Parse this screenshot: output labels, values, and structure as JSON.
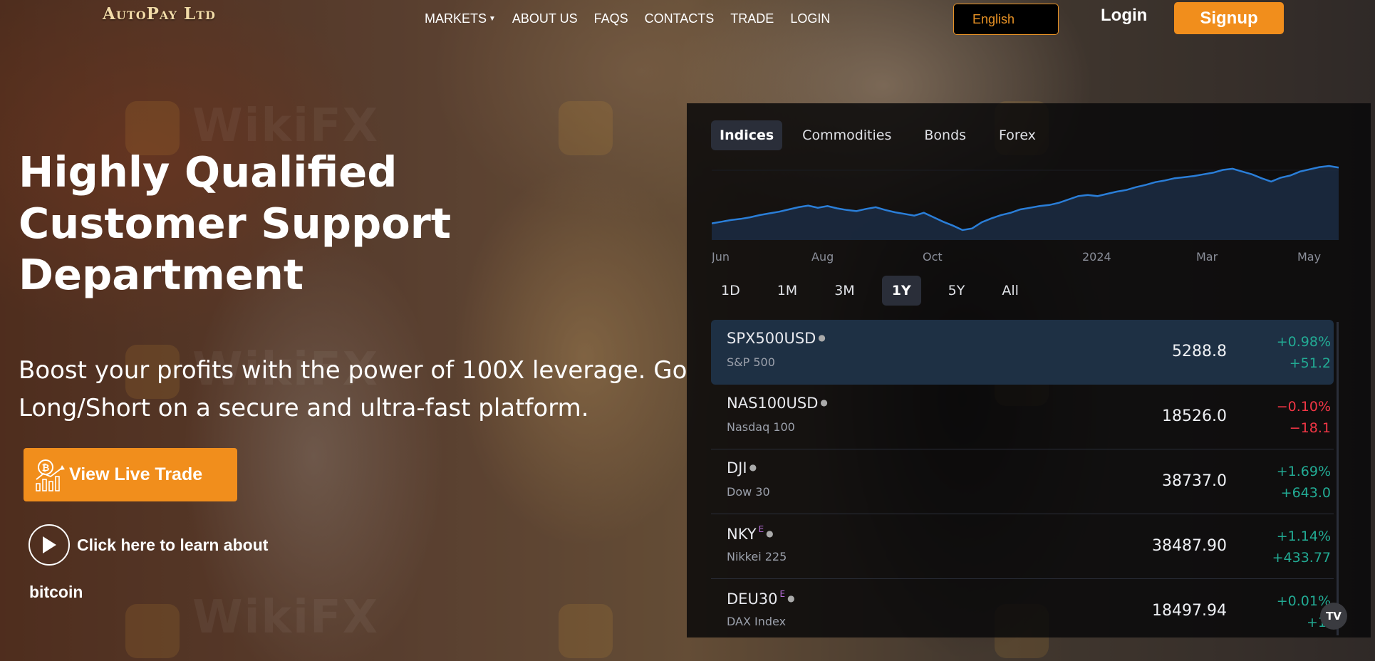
{
  "brand": {
    "logo_text": "AutoPay Ltd"
  },
  "nav": {
    "items": [
      {
        "label": "MARKETS",
        "has_dropdown": true
      },
      {
        "label": "ABOUT US"
      },
      {
        "label": "FAQS"
      },
      {
        "label": "CONTACTS"
      },
      {
        "label": "TRADE"
      },
      {
        "label": "LOGIN"
      }
    ],
    "language": "English",
    "login_label": "Login",
    "signup_label": "Signup"
  },
  "hero": {
    "title_lines": [
      "Highly Qualified",
      "Customer Support",
      "Department"
    ],
    "subtitle": "Boost your profits with the power of 100X leverage. Go Long/Short on a secure and ultra-fast platform.",
    "cta_label": "View Live Trade",
    "learn_line1": "Click here to learn about",
    "learn_line2": "bitcoin"
  },
  "watermark": {
    "text": "WikiFX"
  },
  "widget": {
    "tabs": [
      "Indices",
      "Commodities",
      "Bonds",
      "Forex"
    ],
    "active_tab": "Indices",
    "ranges": [
      "1D",
      "1M",
      "3M",
      "1Y",
      "5Y",
      "All"
    ],
    "active_range": "1Y",
    "badge": "TV",
    "rows": [
      {
        "symbol": "SPX500USD",
        "name": "S&P 500",
        "price": "5288.8",
        "change_pct": "+0.98%",
        "change_abs": "+51.2",
        "direction": "up",
        "superscript": ""
      },
      {
        "symbol": "NAS100USD",
        "name": "Nasdaq 100",
        "price": "18526.0",
        "change_pct": "−0.10%",
        "change_abs": "−18.1",
        "direction": "down",
        "superscript": ""
      },
      {
        "symbol": "DJI",
        "name": "Dow 30",
        "price": "38737.0",
        "change_pct": "+1.69%",
        "change_abs": "+643.0",
        "direction": "up",
        "superscript": ""
      },
      {
        "symbol": "NKY",
        "name": "Nikkei 225",
        "price": "38487.90",
        "change_pct": "+1.14%",
        "change_abs": "+433.77",
        "direction": "up",
        "superscript": "E"
      },
      {
        "symbol": "DEU30",
        "name": "DAX Index",
        "price": "18497.94",
        "change_pct": "+0.01%",
        "change_abs": "+1.",
        "direction": "up",
        "superscript": "E"
      }
    ]
  },
  "chart_data": {
    "type": "area",
    "x_tick_labels": [
      "Jun",
      "Aug",
      "Oct",
      "2024",
      "Mar",
      "May"
    ],
    "y": [
      4270,
      4300,
      4330,
      4350,
      4380,
      4420,
      4450,
      4480,
      4520,
      4560,
      4590,
      4550,
      4580,
      4540,
      4510,
      4490,
      4530,
      4560,
      4510,
      4470,
      4440,
      4410,
      4460,
      4380,
      4300,
      4230,
      4150,
      4180,
      4290,
      4360,
      4420,
      4460,
      4520,
      4550,
      4580,
      4600,
      4640,
      4700,
      4760,
      4780,
      4760,
      4800,
      4840,
      4870,
      4920,
      4960,
      5010,
      5040,
      5080,
      5100,
      5120,
      5150,
      5180,
      5230,
      5250,
      5200,
      5150,
      5080,
      5020,
      5090,
      5130,
      5200,
      5240,
      5280,
      5300,
      5270
    ],
    "line_color": "#2a7ed8",
    "fill_color": "#1b2a40",
    "grid": false
  }
}
